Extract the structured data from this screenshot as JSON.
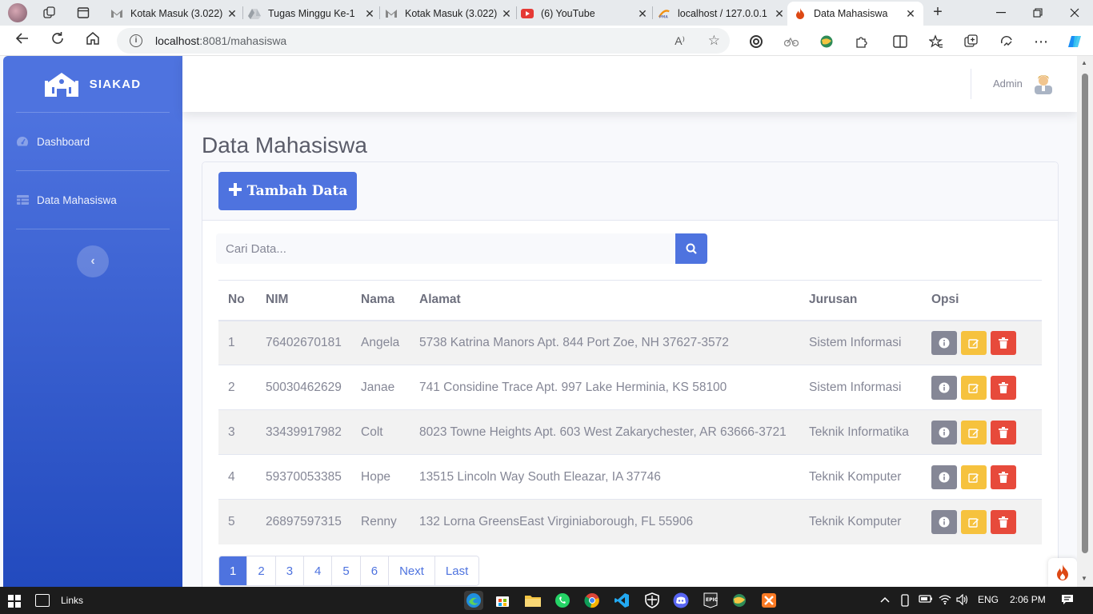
{
  "browser": {
    "tabs": [
      {
        "title": "Kotak Masuk (3.022)",
        "favicon": "gmail-icon",
        "close": "✕"
      },
      {
        "title": "Tugas Minggu Ke-1",
        "favicon": "drive-icon",
        "close": "✕"
      },
      {
        "title": "Kotak Masuk (3.022)",
        "favicon": "gmail-icon",
        "close": "✕"
      },
      {
        "title": "(6) YouTube",
        "favicon": "youtube-icon",
        "close": "✕"
      },
      {
        "title": "localhost / 127.0.0.1",
        "favicon": "phpmyadmin-icon",
        "close": "✕"
      },
      {
        "title": "Data Mahasiswa",
        "favicon": "flame-icon",
        "close": "✕",
        "active": true
      }
    ],
    "url_host": "localhost",
    "url_path": ":8081/mahasiswa",
    "read_aloud": "A⁾"
  },
  "app": {
    "brand": "SIAKAD",
    "sidebar": {
      "items": [
        {
          "label": "Dashboard",
          "icon": "tachometer-icon"
        },
        {
          "label": "Data Mahasiswa",
          "icon": "table-icon"
        }
      ],
      "toggle": "‹"
    },
    "topbar": {
      "user_name": "Admin"
    },
    "page_title": "Data Mahasiswa",
    "add_button": "Tambah Data",
    "search": {
      "placeholder": "Cari Data..."
    },
    "table": {
      "headers": [
        "No",
        "NIM",
        "Nama",
        "Alamat",
        "Jurusan",
        "Opsi"
      ],
      "rows": [
        {
          "no": "1",
          "nim": "76402670181",
          "nama": "Angela",
          "alamat": "5738 Katrina Manors Apt. 844 Port Zoe, NH 37627-3572",
          "jurusan": "Sistem Informasi"
        },
        {
          "no": "2",
          "nim": "50030462629",
          "nama": "Janae",
          "alamat": "741 Considine Trace Apt. 997 Lake Herminia, KS 58100",
          "jurusan": "Sistem Informasi"
        },
        {
          "no": "3",
          "nim": "33439917982",
          "nama": "Colt",
          "alamat": "8023 Towne Heights Apt. 603 West Zakarychester, AR 63666-3721",
          "jurusan": "Teknik Informatika"
        },
        {
          "no": "4",
          "nim": "59370053385",
          "nama": "Hope",
          "alamat": "13515 Lincoln Way South Eleazar, IA 37746",
          "jurusan": "Teknik Komputer"
        },
        {
          "no": "5",
          "nim": "26897597315",
          "nama": "Renny",
          "alamat": "132 Lorna GreensEast Virginiaborough, FL 55906",
          "jurusan": "Teknik Komputer"
        }
      ]
    },
    "pagination": [
      "1",
      "2",
      "3",
      "4",
      "5",
      "6",
      "Next",
      "Last"
    ],
    "pagination_active": "1"
  },
  "taskbar": {
    "links_label": "Links",
    "language": "ENG",
    "time": "2:06 PM"
  },
  "colors": {
    "primary": "#4e73df",
    "warning": "#f6c23e",
    "danger": "#e74a3b",
    "secondary": "#858796"
  }
}
